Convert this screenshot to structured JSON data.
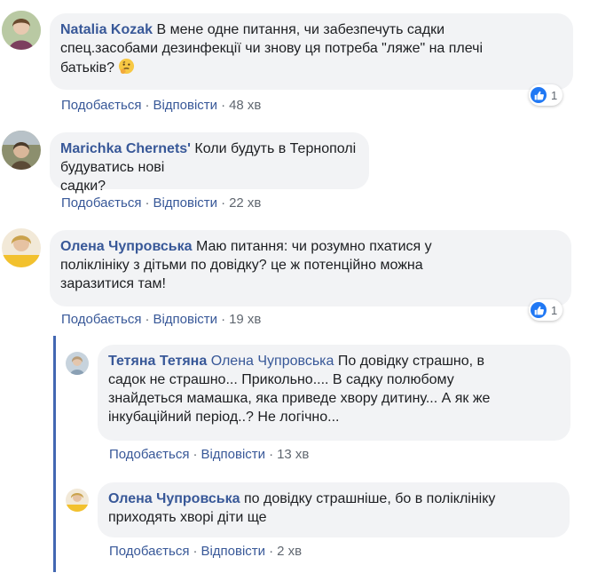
{
  "colors": {
    "link": "#385898",
    "bubble": "#f2f3f5",
    "meta": "#606770",
    "like": "#2078f4",
    "thread_line": "#4267b2"
  },
  "actions": {
    "like": "Подобається",
    "reply": "Відповісти"
  },
  "comments": [
    {
      "author": "Natalia Kozak",
      "text_line1": "В мене одне питання, чи забезпечуть садки",
      "text_line2": "спец.засобами дезинфекції чи знову ця потреба \"ляже\" на плечі",
      "text_line3": "батьків?",
      "emoji": "thinking-face-icon",
      "time": "48 хв",
      "reactions": {
        "icon": "like-icon",
        "count": "1"
      }
    },
    {
      "author": "Marichka Chernets'",
      "text_line1": "Коли будуть в Тернополі будуватись нові",
      "text_line2": "садки?",
      "time": "22 хв"
    },
    {
      "author": "Олена Чупровська",
      "text_line1": "Маю питання: чи розумно пхатися у",
      "text_line2": "поліклініку з дітьми по довідку? це ж потенційно можна",
      "text_line3": "заразитися там!",
      "time": "19 хв",
      "reactions": {
        "icon": "like-icon",
        "count": "1"
      }
    }
  ],
  "replies": [
    {
      "author": "Тетяна Тетяна",
      "mention": "Олена Чупровська",
      "text_line1": "По довідку страшно, в",
      "text_line2": "садок не страшно... Прикольно.... В садку полюбому",
      "text_line3": "знайдеться мамашка, яка приведе хвору дитину... А як же",
      "text_line4": "інкубаційний період..? Не логічно...",
      "time": "13 хв"
    },
    {
      "author": "Олена Чупровська",
      "text_line1": "по довідку страшніше, бо в поліклініку",
      "text_line2": "приходять хворі діти ще",
      "time": "2 хв"
    }
  ]
}
